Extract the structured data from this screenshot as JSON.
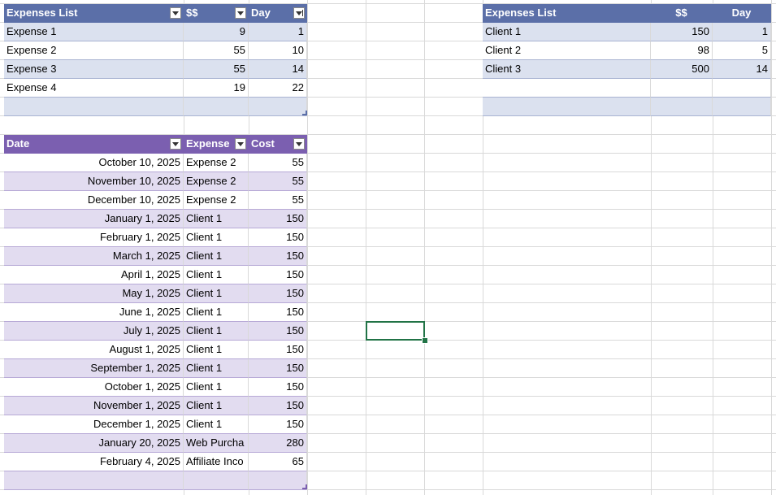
{
  "expenses_table": {
    "headers": [
      "Expenses List",
      "$$",
      "Day"
    ],
    "rows": [
      [
        "Expense 1",
        "9",
        "1"
      ],
      [
        "Expense 2",
        "55",
        "10"
      ],
      [
        "Expense 3",
        "55",
        "14"
      ],
      [
        "Expense 4",
        "19",
        "22"
      ]
    ]
  },
  "clients_table": {
    "headers": [
      "Expenses List",
      "$$",
      "Day"
    ],
    "rows": [
      [
        "Client 1",
        "150",
        "1"
      ],
      [
        "Client 2",
        "98",
        "5"
      ],
      [
        "Client 3",
        "500",
        "14"
      ]
    ]
  },
  "ledger_table": {
    "headers": [
      "Date",
      "Expense",
      "Cost"
    ],
    "rows": [
      [
        "October 10, 2025",
        "Expense 2",
        "55"
      ],
      [
        "November 10, 2025",
        "Expense 2",
        "55"
      ],
      [
        "December 10, 2025",
        "Expense 2",
        "55"
      ],
      [
        "January 1, 2025",
        "Client 1",
        "150"
      ],
      [
        "February 1, 2025",
        "Client 1",
        "150"
      ],
      [
        "March 1, 2025",
        "Client 1",
        "150"
      ],
      [
        "April 1, 2025",
        "Client 1",
        "150"
      ],
      [
        "May 1, 2025",
        "Client 1",
        "150"
      ],
      [
        "June 1, 2025",
        "Client 1",
        "150"
      ],
      [
        "July 1, 2025",
        "Client 1",
        "150"
      ],
      [
        "August 1, 2025",
        "Client 1",
        "150"
      ],
      [
        "September 1, 2025",
        "Client 1",
        "150"
      ],
      [
        "October 1, 2025",
        "Client 1",
        "150"
      ],
      [
        "November 1, 2025",
        "Client 1",
        "150"
      ],
      [
        "December 1, 2025",
        "Client 1",
        "150"
      ],
      [
        "January 20, 2025",
        "Web Purcha",
        "280"
      ],
      [
        "February 4, 2025",
        "Affiliate Inco",
        "65"
      ]
    ]
  },
  "colors": {
    "blue_header": "#5b6fa8",
    "blue_band": "#dbe1ef",
    "purple_header": "#7b5fb0",
    "purple_band": "#e2dcf0",
    "selection": "#217346"
  }
}
